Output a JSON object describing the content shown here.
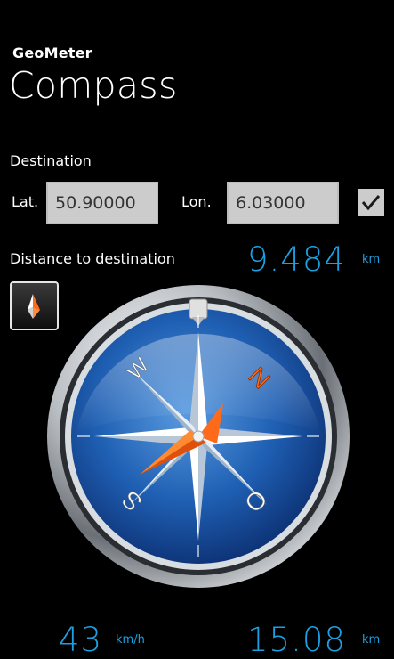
{
  "app": {
    "name": "GeoMeter",
    "page_title": "Compass"
  },
  "destination": {
    "section_label": "Destination",
    "lat_label": "Lat.",
    "lat_value": "50.90000",
    "lon_label": "Lon.",
    "lon_value": "6.03000",
    "enabled": true
  },
  "distance": {
    "label": "Distance to destination",
    "value": "9.484",
    "unit": "km"
  },
  "compass": {
    "letters": {
      "north": "N",
      "east": "O",
      "south": "S",
      "west": "W"
    }
  },
  "speed": {
    "value": "43",
    "unit": "km/h"
  },
  "trip": {
    "value": "15.08",
    "unit": "km"
  },
  "colors": {
    "accent": "#1ba1e2",
    "needle": "#ff6a1a",
    "field": "#cccccc",
    "background": "#000000"
  }
}
